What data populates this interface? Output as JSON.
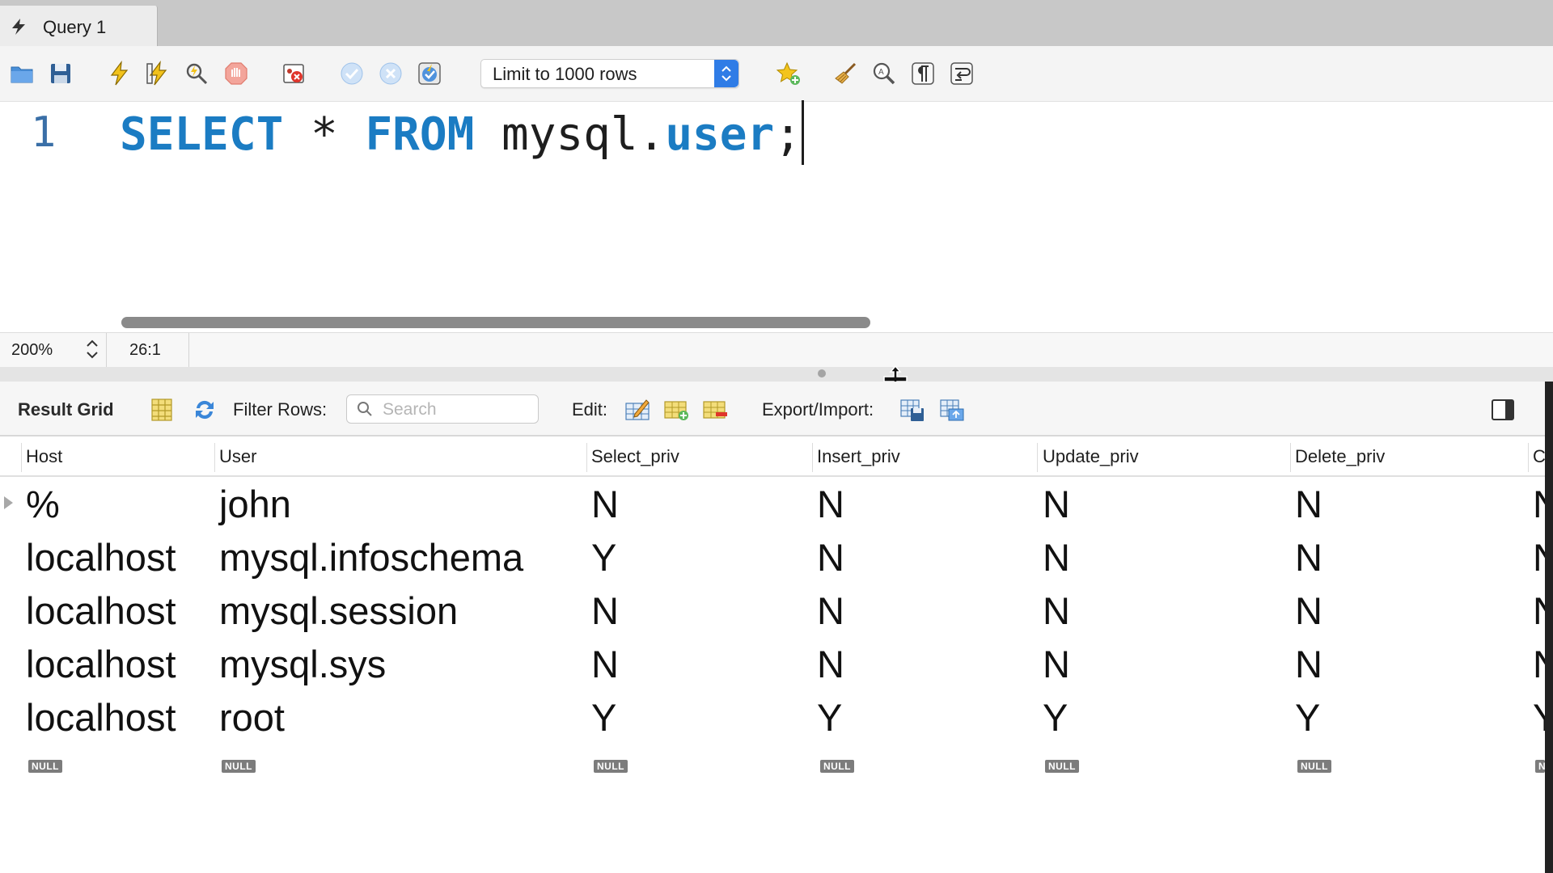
{
  "tab": {
    "title": "Query 1"
  },
  "toolbar": {
    "limit_select_value": "Limit to 1000 rows",
    "icons": [
      "open-folder-icon",
      "save-icon",
      "execute-icon",
      "execute-current-icon",
      "explain-icon",
      "stop-icon",
      "error-toggle-icon",
      "commit-icon",
      "rollback-icon",
      "autocommit-icon",
      "bookmark-star-icon",
      "beautify-broom-icon",
      "find-magnifier-icon",
      "invisible-chars-icon",
      "word-wrap-icon"
    ]
  },
  "editor": {
    "line_number": "1",
    "tokens": {
      "kw_select": "SELECT",
      "star": "*",
      "kw_from": "FROM",
      "schema": "mysql",
      "dot": ".",
      "table": "user",
      "semicolon": ";"
    }
  },
  "status": {
    "zoom": "200%",
    "cursor_position": "26:1"
  },
  "result_toolbar": {
    "title": "Result Grid",
    "filter_label": "Filter Rows:",
    "search_placeholder": "Search",
    "edit_label": "Edit:",
    "export_label": "Export/Import:"
  },
  "grid": {
    "columns": [
      "Host",
      "User",
      "Select_priv",
      "Insert_priv",
      "Update_priv",
      "Delete_priv",
      "C"
    ],
    "rows": [
      [
        "%",
        "john",
        "N",
        "N",
        "N",
        "N",
        "N"
      ],
      [
        "localhost",
        "mysql.infoschema",
        "Y",
        "N",
        "N",
        "N",
        "N"
      ],
      [
        "localhost",
        "mysql.session",
        "N",
        "N",
        "N",
        "N",
        "N"
      ],
      [
        "localhost",
        "mysql.sys",
        "N",
        "N",
        "N",
        "N",
        "N"
      ],
      [
        "localhost",
        "root",
        "Y",
        "Y",
        "Y",
        "Y",
        "Y"
      ]
    ],
    "null_label": "NULL"
  },
  "colors": {
    "keyword": "#1b7cc3",
    "line_number": "#3a6fa7",
    "select_accent": "#2f7ce6"
  }
}
